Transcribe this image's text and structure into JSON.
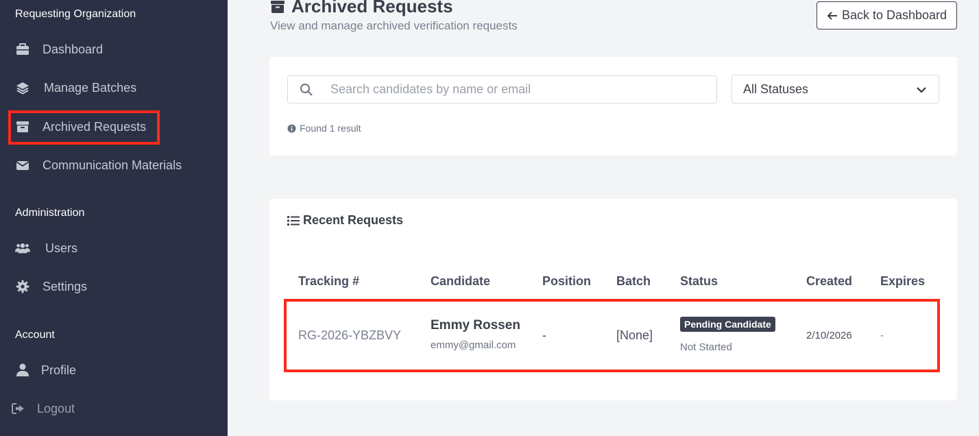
{
  "sidebar": {
    "sections": {
      "org": "Requesting Organization",
      "admin": "Administration",
      "account": "Account"
    },
    "items": {
      "dashboard": "Dashboard",
      "manage_batches": "Manage Batches",
      "archived_requests": "Archived Requests",
      "communication_materials": "Communication Materials",
      "users": "Users",
      "settings": "Settings",
      "profile": "Profile",
      "logout": "Logout"
    },
    "active_item": "Archived Requests"
  },
  "header": {
    "title": "Archived Requests",
    "subtitle": "View and manage archived verification requests",
    "back_button": "Back to Dashboard"
  },
  "filters": {
    "search_placeholder": "Search candidates by name or email",
    "search_value": "",
    "status_selected": "All Statuses",
    "result_text": "Found 1 result"
  },
  "table": {
    "title": "Recent Requests",
    "columns": {
      "tracking": "Tracking #",
      "candidate": "Candidate",
      "position": "Position",
      "batch": "Batch",
      "status": "Status",
      "created": "Created",
      "expires": "Expires"
    },
    "rows": [
      {
        "tracking": "RG-2026-YBZBVY",
        "candidate_name": "Emmy Rossen",
        "candidate_email": "emmy@gmail.com",
        "position": "-",
        "batch": "[None]",
        "status_badge": "Pending Candidate",
        "status_sub": "Not Started",
        "created": "2/10/2026",
        "expires": "-"
      }
    ]
  },
  "colors": {
    "sidebar_bg": "#2b3044",
    "highlight": "#ff2a1a",
    "badge_bg": "#3d4250"
  }
}
